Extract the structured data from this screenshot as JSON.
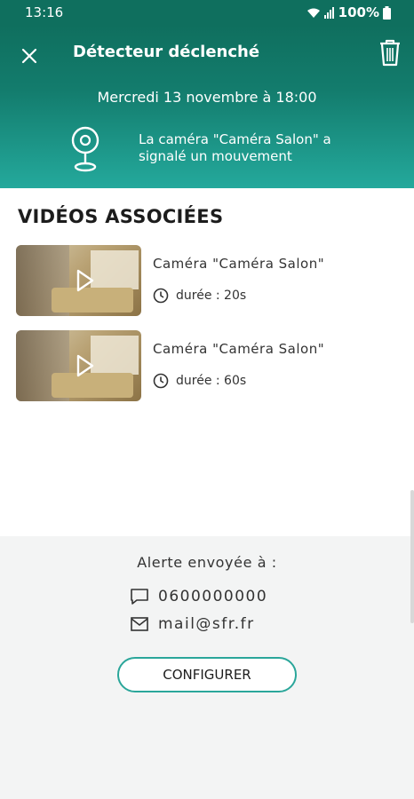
{
  "status_bar": {
    "time": "13:16",
    "battery": "100%"
  },
  "header": {
    "title": "Détecteur déclenché",
    "date": "Mercredi 13 novembre à 18:00",
    "message": "La caméra \"Caméra Salon\" a signalé un mouvement"
  },
  "videos": {
    "section_title": "VIDÉOS ASSOCIÉES",
    "items": [
      {
        "camera": "Caméra \"Caméra Salon\"",
        "duration": "durée : 20s"
      },
      {
        "camera": "Caméra \"Caméra Salon\"",
        "duration": "durée : 60s"
      }
    ]
  },
  "alert": {
    "sent_to": "Alerte envoyée à :",
    "phone": "0600000000",
    "email": "mail@sfr.fr",
    "configure_label": "CONFIGURER"
  },
  "icons": [
    "close-icon",
    "trash-icon",
    "camera-icon",
    "play-icon",
    "clock-icon",
    "sms-icon",
    "email-icon",
    "wifi-icon",
    "signal-icon",
    "battery-icon"
  ],
  "colors": {
    "header_dark": "#0f6f5e",
    "header_light": "#24a99c",
    "button_border": "#2aa69a"
  }
}
